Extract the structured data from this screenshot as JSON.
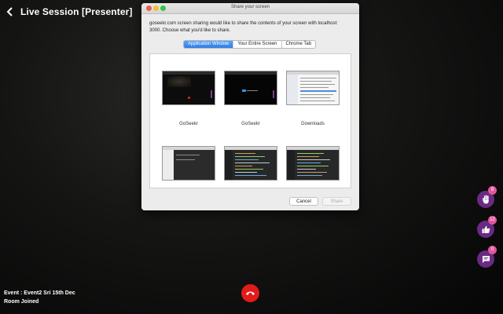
{
  "session": {
    "title": "Live Session [Presenter]"
  },
  "event": {
    "line1": "Event : Event2 Sri 15th Dec",
    "line2": "Room Joined"
  },
  "actions": {
    "raise_hand_count": "8",
    "like_count": "12",
    "chat_count": "0"
  },
  "dialog": {
    "title": "Share your screen",
    "prompt": "goseekr.com screen sharing would like to share the contents of your screen with localhost: 3000. Choose what you'd like to share.",
    "tabs": [
      {
        "label": "Application Window",
        "active": true
      },
      {
        "label": "Your Entire Screen",
        "active": false
      },
      {
        "label": "Chrome Tab",
        "active": false
      }
    ],
    "windows": [
      {
        "label": "GoSeekr"
      },
      {
        "label": "GoSeekr"
      },
      {
        "label": "Downloads"
      },
      {
        "label": ""
      },
      {
        "label": ""
      },
      {
        "label": ""
      }
    ],
    "cancel_label": "Cancel",
    "share_label": "Share"
  },
  "colors": {
    "end_call": "#e21b1b",
    "action_button": "#6a2a83",
    "badge": "#e0579c",
    "tab_active": "#2f7de6"
  },
  "icons": {
    "back": "chevron-left-icon",
    "end_call": "phone-hangup-icon",
    "raise_hand": "hand-icon",
    "like": "thumbs-up-icon",
    "chat": "chat-icon"
  }
}
